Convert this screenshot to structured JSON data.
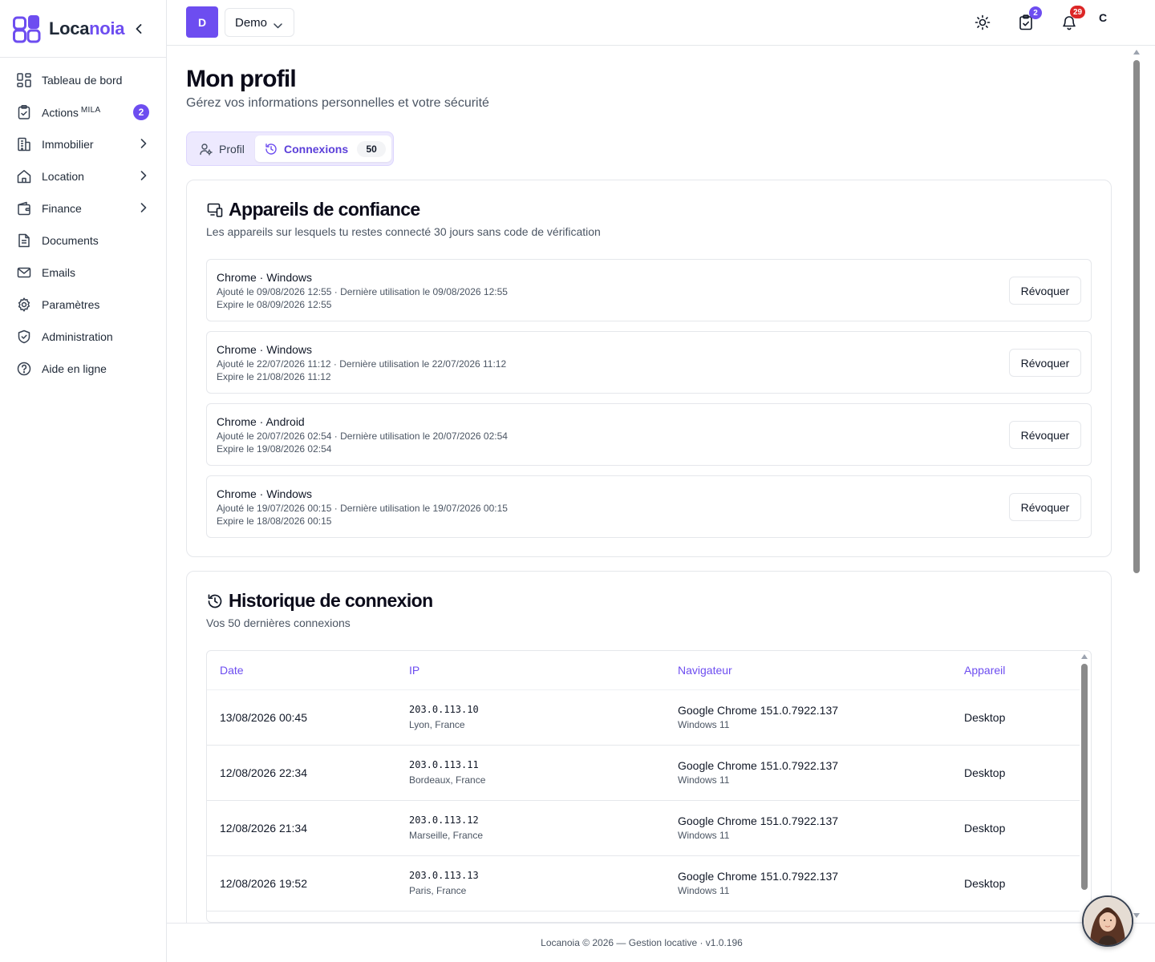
{
  "brand": {
    "name_main": "Loca",
    "name_accent": "noia"
  },
  "sidebar": {
    "items": [
      {
        "label": "Tableau de bord",
        "icon": "dashboard-icon"
      },
      {
        "label": "Actions",
        "sup": "MILA",
        "badge": "2",
        "icon": "clipboard-check-icon"
      },
      {
        "label": "Immobilier",
        "icon": "building-icon",
        "expandable": true
      },
      {
        "label": "Location",
        "icon": "home-icon",
        "expandable": true
      },
      {
        "label": "Finance",
        "icon": "wallet-icon",
        "expandable": true
      },
      {
        "label": "Documents",
        "icon": "document-icon"
      },
      {
        "label": "Emails",
        "icon": "mail-icon"
      },
      {
        "label": "Paramètres",
        "icon": "gear-icon"
      },
      {
        "label": "Administration",
        "icon": "shield-icon"
      },
      {
        "label": "Aide en ligne",
        "icon": "help-circle-icon"
      }
    ]
  },
  "topbar": {
    "org_initial": "D",
    "org_name": "Demo",
    "tasks_badge": "2",
    "notifications_badge": "29",
    "user_initial": "C"
  },
  "page": {
    "title": "Mon profil",
    "subtitle": "Gérez vos informations personnelles et votre sécurité"
  },
  "tabs": [
    {
      "label": "Profil"
    },
    {
      "label": "Connexions",
      "count": "50"
    }
  ],
  "trusted": {
    "title": "Appareils de confiance",
    "subtitle": "Les appareils sur lesquels tu restes connecté 30 jours sans code de vérification",
    "revoke_label": "Révoquer",
    "devices": [
      {
        "name": "Chrome · Windows",
        "added": "Ajouté le 09/08/2026 12:55 · Dernière utilisation le 09/08/2026 12:55",
        "expires": "Expire le 08/09/2026 12:55"
      },
      {
        "name": "Chrome · Windows",
        "added": "Ajouté le 22/07/2026 11:12 · Dernière utilisation le 22/07/2026 11:12",
        "expires": "Expire le 21/08/2026 11:12"
      },
      {
        "name": "Chrome · Android",
        "added": "Ajouté le 20/07/2026 02:54 · Dernière utilisation le 20/07/2026 02:54",
        "expires": "Expire le 19/08/2026 02:54"
      },
      {
        "name": "Chrome · Windows",
        "added": "Ajouté le 19/07/2026 00:15 · Dernière utilisation le 19/07/2026 00:15",
        "expires": "Expire le 18/08/2026 00:15"
      }
    ]
  },
  "history": {
    "title": "Historique de connexion",
    "subtitle": "Vos 50 dernières connexions",
    "columns": {
      "date": "Date",
      "ip": "IP",
      "browser": "Navigateur",
      "device": "Appareil"
    },
    "rows": [
      {
        "date": "13/08/2026 00:45",
        "ip": "203.0.113.10",
        "location": "Lyon, France",
        "browser": "Google Chrome 151.0.7922.137",
        "os": "Windows 11",
        "device": "Desktop"
      },
      {
        "date": "12/08/2026 22:34",
        "ip": "203.0.113.11",
        "location": "Bordeaux, France",
        "browser": "Google Chrome 151.0.7922.137",
        "os": "Windows 11",
        "device": "Desktop"
      },
      {
        "date": "12/08/2026 21:34",
        "ip": "203.0.113.12",
        "location": "Marseille, France",
        "browser": "Google Chrome 151.0.7922.137",
        "os": "Windows 11",
        "device": "Desktop"
      },
      {
        "date": "12/08/2026 19:52",
        "ip": "203.0.113.13",
        "location": "Paris, France",
        "browser": "Google Chrome 151.0.7922.137",
        "os": "Windows 11",
        "device": "Desktop"
      }
    ]
  },
  "footer": {
    "text": "Locanoia © 2026 — Gestion locative · v1.0.196"
  },
  "colors": {
    "accent": "#6d4df0",
    "badge_red": "#dc2626",
    "text": "#111827",
    "muted": "#4b5563",
    "border": "#e5e7eb"
  }
}
